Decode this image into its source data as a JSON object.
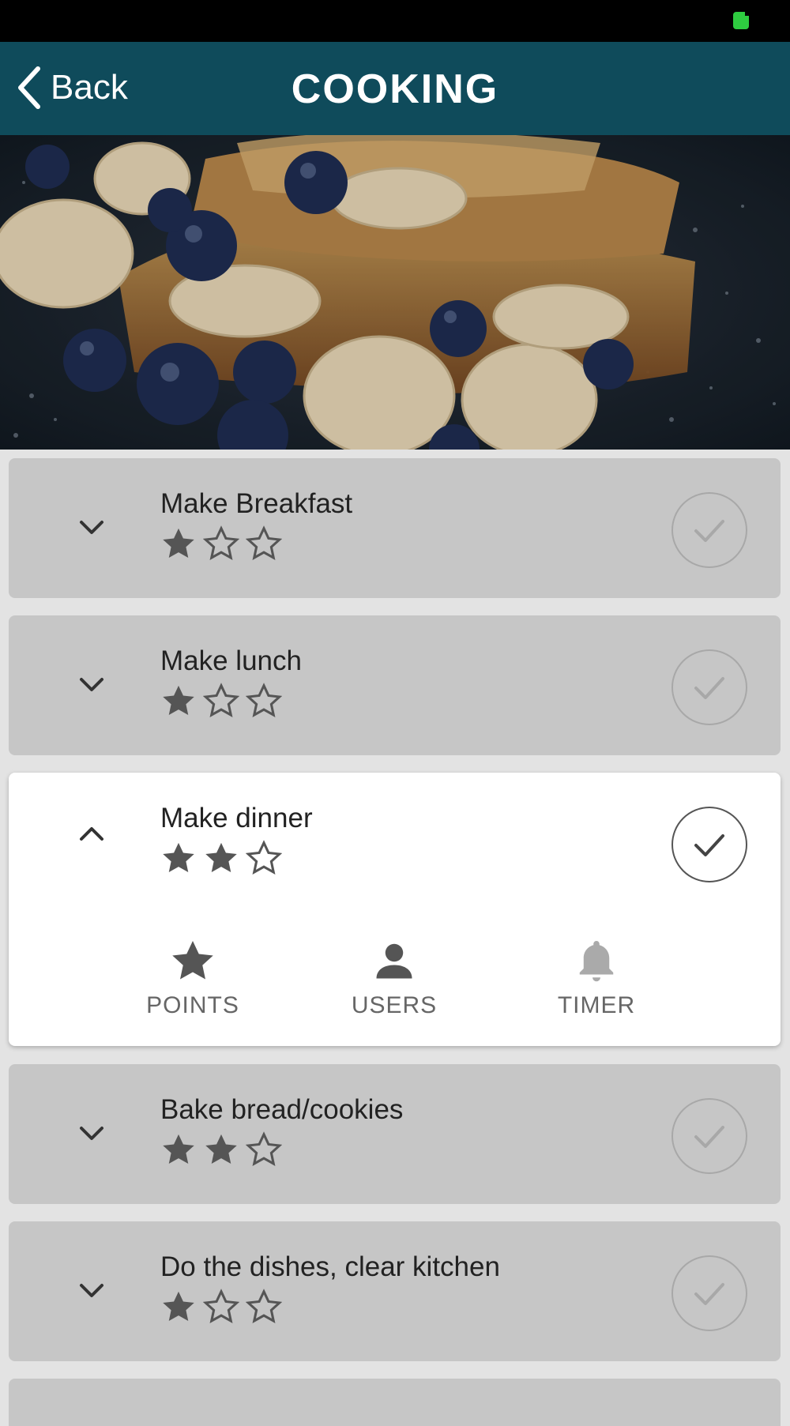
{
  "status_bar": {
    "battery_color": "#2ecc40",
    "icons": [
      "battery-icon"
    ]
  },
  "nav": {
    "back_label": "Back",
    "title": "COOKING",
    "background": "#0f4b5b",
    "back_icon": "chevron-left-icon"
  },
  "hero": {
    "image": "french-toast-with-banana-and-blueberries-photo"
  },
  "tasks": [
    {
      "title": "Make Breakfast",
      "points": 1,
      "max_points": 3,
      "completed": false,
      "expanded": false
    },
    {
      "title": "Make lunch",
      "points": 1,
      "max_points": 3,
      "completed": false,
      "expanded": false
    },
    {
      "title": "Make dinner",
      "points": 2,
      "max_points": 3,
      "completed": false,
      "expanded": true
    },
    {
      "title": "Bake bread/cookies",
      "points": 2,
      "max_points": 3,
      "completed": false,
      "expanded": false
    },
    {
      "title": "Do the dishes, clear kitchen",
      "points": 1,
      "max_points": 3,
      "completed": false,
      "expanded": false
    }
  ],
  "expanded_actions": [
    {
      "label": "POINTS",
      "icon": "star-icon"
    },
    {
      "label": "USERS",
      "icon": "user-icon"
    },
    {
      "label": "TIMER",
      "icon": "bell-icon"
    }
  ],
  "colors": {
    "card_collapsed": "#c6c6c6",
    "card_expanded": "#ffffff",
    "star": "#555555"
  }
}
